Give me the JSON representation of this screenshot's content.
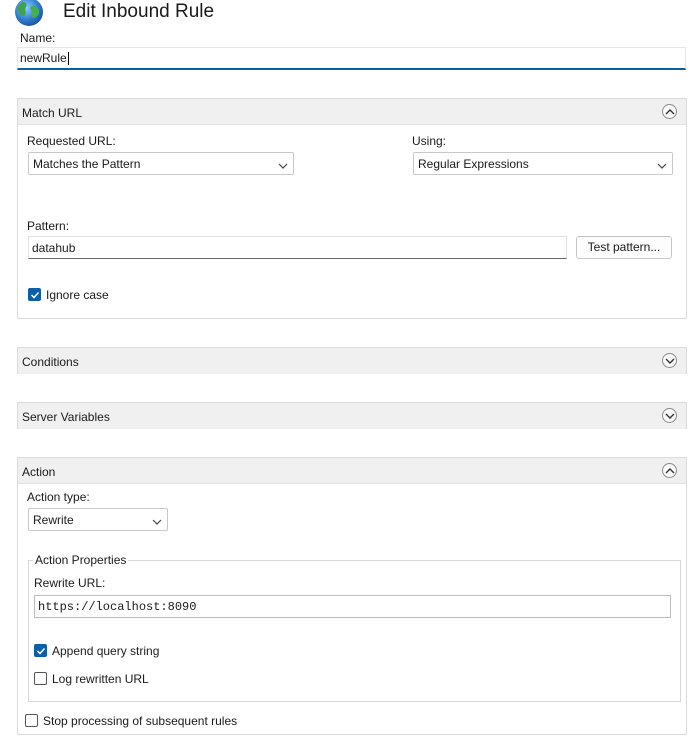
{
  "window": {
    "title": "Edit Inbound Rule",
    "icon": "globe-icon"
  },
  "name": {
    "label": "Name:",
    "value": "newRule"
  },
  "match_url": {
    "title": "Match URL",
    "requested_url_label": "Requested URL:",
    "requested_url_value": "Matches the Pattern",
    "using_label": "Using:",
    "using_value": "Regular Expressions",
    "pattern_label": "Pattern:",
    "pattern_value": "datahub",
    "test_pattern_label": "Test pattern...",
    "ignore_case_label": "Ignore case",
    "ignore_case_checked": true
  },
  "conditions": {
    "title": "Conditions"
  },
  "server_variables": {
    "title": "Server Variables"
  },
  "action": {
    "title": "Action",
    "action_type_label": "Action type:",
    "action_type_value": "Rewrite",
    "properties_title": "Action Properties",
    "rewrite_url_label": "Rewrite URL:",
    "rewrite_url_value": "https://localhost:8090",
    "append_query_label": "Append query string",
    "append_query_checked": true,
    "log_rewritten_label": "Log rewritten URL",
    "log_rewritten_checked": false,
    "stop_processing_label": "Stop processing of subsequent rules",
    "stop_processing_checked": false
  },
  "colors": {
    "accent": "#0a5fa8",
    "header_bg": "#f0f0f0",
    "border": "#dcdcdc"
  }
}
